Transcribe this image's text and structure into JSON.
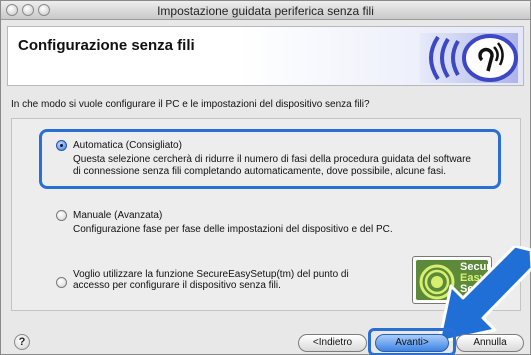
{
  "window": {
    "title": "Impostazione guidata periferica senza fili"
  },
  "header": {
    "title": "Configurazione senza fili"
  },
  "question": "In che modo si vuole configurare il PC e le impostazioni del dispositivo senza fili?",
  "options": [
    {
      "label": "Automatica (Consigliato)",
      "desc1": "Questa selezione cercherà di ridurre il numero di fasi della procedura guidata del software",
      "desc2": "di connessione senza fili completando automaticamente, dove possibile, alcune fasi.",
      "selected": true
    },
    {
      "label": "Manuale (Avanzata)",
      "desc1": "Configurazione fase per fase delle impostazioni del dispositivo e del PC.",
      "selected": false
    },
    {
      "label1": "Voglio utilizzare la funzione SecureEasySetup(tm) del punto di",
      "label2": "accesso per configurare il dispositivo senza fili.",
      "selected": false
    }
  ],
  "badge": {
    "line1": "Secure",
    "line2": "Easy",
    "line3": "Se"
  },
  "buttons": {
    "help": "?",
    "back": "<Indietro",
    "next": "Avanti>",
    "cancel": "Annulla"
  },
  "colors": {
    "accent": "#2a6fd4",
    "arrow": "#1f6fd6",
    "badge_green": "#5d8a3a"
  }
}
